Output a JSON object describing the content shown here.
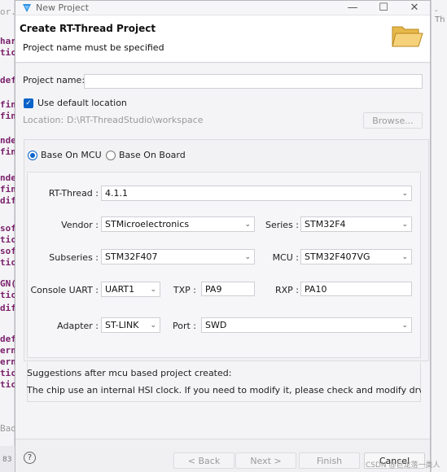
{
  "window": {
    "title": "New Project",
    "controls": {
      "minimize": "—",
      "maximize": "☐",
      "close": "✕"
    }
  },
  "background": {
    "left_code": [
      "or...",
      "har",
      "tic",
      "def",
      "fin",
      "fin",
      "nde",
      "fin",
      "nde",
      "fin",
      "dif",
      "sof",
      "tic",
      "sof",
      "tic",
      "GN(",
      "tic",
      "dif",
      "def",
      "ern",
      "ern",
      "tic",
      "tic",
      "Bad"
    ],
    "right_tab": "-Th",
    "bottom_left": "83",
    "watermark": "CSDN @巨龙落一类人"
  },
  "header": {
    "title": "Create RT-Thread Project",
    "message": "Project name must be specified",
    "icon": "folder-open-icon"
  },
  "form": {
    "project_name_label": "Project name:",
    "project_name_value": "",
    "use_default_location_label": "Use default location",
    "location_label": "Location:",
    "location_value": "D:\\RT-ThreadStudio\\workspace",
    "browse_label": "Browse...",
    "base_on_mcu_label": "Base On MCU",
    "base_on_board_label": "Base On Board",
    "rtthread_label": "RT-Thread :",
    "rtthread_value": "4.1.1",
    "vendor_label": "Vendor :",
    "vendor_value": "STMicroelectronics",
    "series_label": "Series :",
    "series_value": "STM32F4",
    "subseries_label": "Subseries :",
    "subseries_value": "STM32F407",
    "mcu_label": "MCU :",
    "mcu_value": "STM32F407VG",
    "console_uart_label": "Console UART :",
    "console_uart_value": "UART1",
    "txp_label": "TXP :",
    "txp_value": "PA9",
    "rxp_label": "RXP :",
    "rxp_value": "PA10",
    "adapter_label": "Adapter :",
    "adapter_value": "ST-LINK",
    "port_label": "Port :",
    "port_value": "SWD",
    "suggestions_title": "Suggestions after mcu based project created:",
    "suggestions_text": "The chip use an internal HSI clock. If you need to modify it, please check and modify drv_clk.c"
  },
  "footer": {
    "help": "?",
    "back": "< Back",
    "next": "Next >",
    "finish": "Finish",
    "cancel": "Cancel"
  }
}
